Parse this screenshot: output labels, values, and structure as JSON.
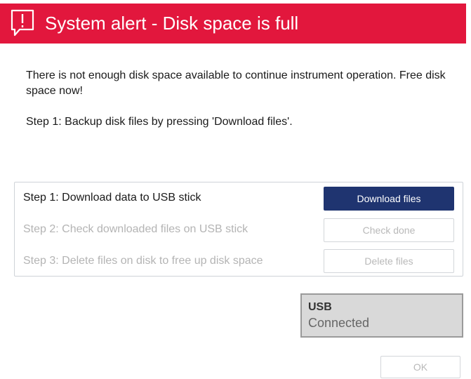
{
  "header": {
    "title": "System alert - Disk space is full",
    "icon": "alert-exclamation-speech-bubble-icon",
    "background_color": "#e2173d"
  },
  "message": {
    "line1": "There is not enough disk space available to continue instrument operation. Free disk space now!",
    "line2": "Step 1: Backup disk files by pressing 'Download files'."
  },
  "steps": [
    {
      "label": "Step 1: Download data to USB stick",
      "button": "Download files",
      "state": "active"
    },
    {
      "label": "Step 2: Check downloaded files on USB stick",
      "button": "Check done",
      "state": "disabled"
    },
    {
      "label": "Step 3: Delete files on disk to free up disk space",
      "button": "Delete files",
      "state": "disabled"
    }
  ],
  "usb": {
    "title": "USB",
    "status": "Connected"
  },
  "footer": {
    "ok_label": "OK"
  },
  "colors": {
    "primary_button": "#1f3470",
    "disabled_text": "#b4b4b4"
  }
}
